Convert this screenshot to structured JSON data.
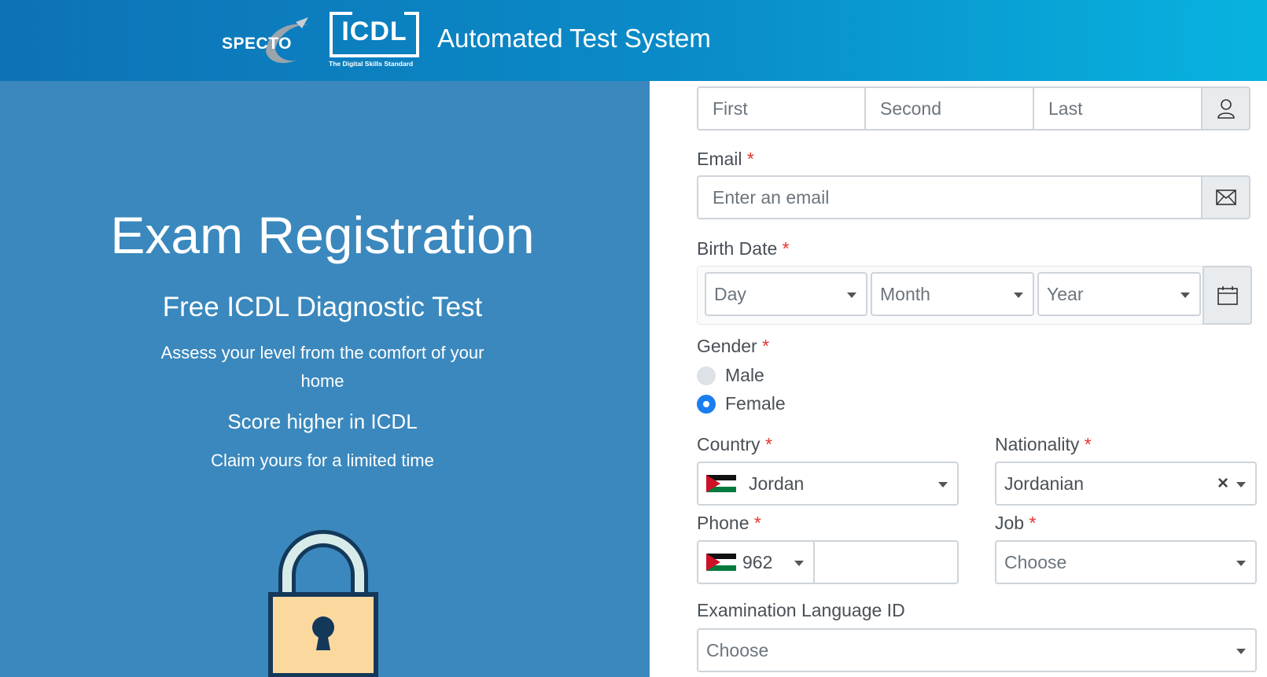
{
  "header": {
    "specto_logo": "SPECTO",
    "icdl_logo": "ICDL",
    "icdl_tagline": "The Digital Skills Standard",
    "app_title": "Automated Test System"
  },
  "hero": {
    "title": "Exam Registration",
    "subtitle": "Free ICDL Diagnostic Test",
    "description": "Assess your level from the comfort of your home",
    "headline": "Score higher in ICDL",
    "tagline": "Claim yours for a limited time",
    "icon": "lock-icon"
  },
  "form": {
    "name": {
      "first_placeholder": "First",
      "second_placeholder": "Second",
      "last_placeholder": "Last",
      "icon": "user-icon"
    },
    "email": {
      "label": "Email",
      "required": "*",
      "placeholder": "Enter an email",
      "icon": "envelope-icon"
    },
    "birth_date": {
      "label": "Birth Date",
      "required": "*",
      "day_placeholder": "Day",
      "month_placeholder": "Month",
      "year_placeholder": "Year",
      "icon": "calendar-icon"
    },
    "gender": {
      "label": "Gender",
      "required": "*",
      "options": [
        "Male",
        "Female"
      ],
      "selected": "Female"
    },
    "country": {
      "label": "Country",
      "required": "*",
      "value": "Jordan",
      "flag": "jordan-flag-icon"
    },
    "nationality": {
      "label": "Nationality",
      "required": "*",
      "value": "Jordanian",
      "clear": "×"
    },
    "phone": {
      "label": "Phone",
      "required": "*",
      "code": "962",
      "value": ""
    },
    "job": {
      "label": "Job",
      "required": "*",
      "placeholder": "Choose"
    },
    "exam_language": {
      "label": "Examination Language ID",
      "placeholder": "Choose"
    }
  },
  "colors": {
    "header_start": "#0d72b6",
    "header_end": "#08b3e0",
    "left_panel": "#3a88bd",
    "required": "#e3342f",
    "radio_on": "#1a7ef0"
  }
}
